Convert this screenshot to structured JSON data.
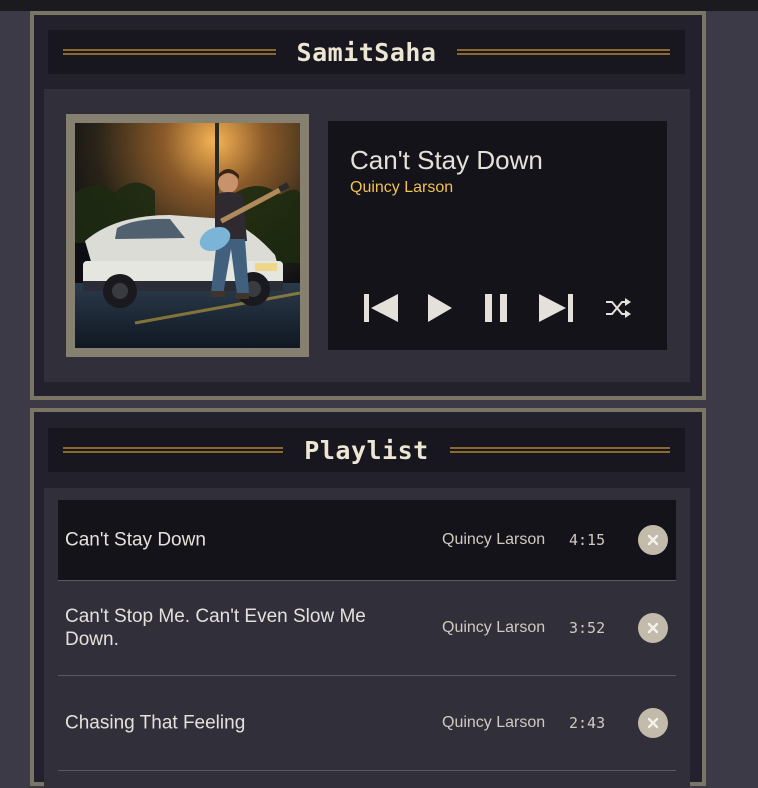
{
  "player": {
    "header": "SamitSaha",
    "now_playing": {
      "title": "Can't Stay Down",
      "artist": "Quincy Larson"
    },
    "album_art": "album-cover-guitarist-on-car",
    "controls": [
      "previous-icon",
      "play-icon",
      "pause-icon",
      "next-icon",
      "shuffle-icon"
    ]
  },
  "playlist": {
    "header": "Playlist",
    "tracks": [
      {
        "title": "Can't Stay Down",
        "artist": "Quincy Larson",
        "duration": "4:15",
        "active": true
      },
      {
        "title": "Can't Stop Me. Can't Even Slow Me Down.",
        "artist": "Quincy Larson",
        "duration": "3:52",
        "active": false
      },
      {
        "title": "Chasing That Feeling",
        "artist": "Quincy Larson",
        "duration": "2:43",
        "active": false
      }
    ],
    "remove_icon": "close-icon"
  },
  "colors": {
    "background": "#3c3a47",
    "panel_border": "#7a7565",
    "accent_gold": "#f2c14e",
    "rule_gold": "#8a6a2c",
    "text_light": "#e4e1da"
  }
}
